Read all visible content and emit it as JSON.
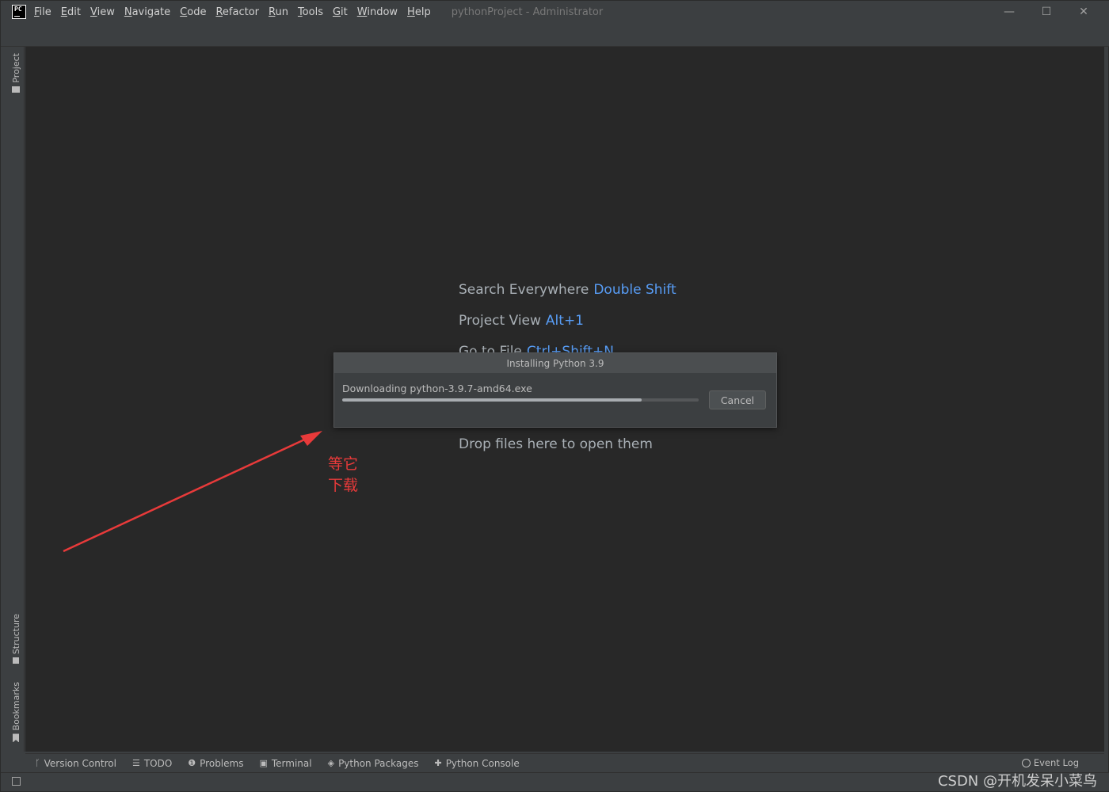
{
  "titlebar": {
    "logo": "PC",
    "menu": [
      {
        "first": "F",
        "rest": "ile"
      },
      {
        "first": "E",
        "rest": "dit"
      },
      {
        "first": "V",
        "rest": "iew"
      },
      {
        "first": "N",
        "rest": "avigate"
      },
      {
        "first": "C",
        "rest": "ode"
      },
      {
        "first": "R",
        "rest": "efactor"
      },
      {
        "first": "R",
        "rest": "un"
      },
      {
        "first": "T",
        "rest": "ools"
      },
      {
        "first": "G",
        "rest": "it"
      },
      {
        "first": "W",
        "rest": "indow"
      },
      {
        "first": "H",
        "rest": "elp"
      }
    ],
    "window_title": "pythonProject - Administrator",
    "controls": {
      "minimize": "—",
      "maximize": "☐",
      "close": "✕"
    }
  },
  "left_stripe": {
    "project": "Project",
    "structure": "Structure",
    "bookmarks": "Bookmarks"
  },
  "editor": {
    "hints": [
      {
        "label": "Search Everywhere",
        "key": "Double Shift"
      },
      {
        "label": "Project View",
        "key": "Alt+1"
      },
      {
        "label": "Go to File",
        "key": "Ctrl+Shift+N"
      }
    ],
    "drop_hint": "Drop files here to open them"
  },
  "dialog": {
    "title": "Installing Python 3.9",
    "status": "Downloading python-3.9.7-amd64.exe",
    "progress": 0.84,
    "cancel_label": "Cancel"
  },
  "annotation": {
    "line1": "等它",
    "line2": "下载",
    "color": "#e83a3a"
  },
  "bottom_bar": {
    "tabs": [
      {
        "icon": "version-control-icon",
        "glyph": "ᚴ",
        "label": "Version Control"
      },
      {
        "icon": "todo-icon",
        "glyph": "☰",
        "label": "TODO"
      },
      {
        "icon": "problems-icon",
        "glyph": "❶",
        "label": "Problems"
      },
      {
        "icon": "terminal-icon",
        "glyph": "▣",
        "label": "Terminal"
      },
      {
        "icon": "python-packages-icon",
        "glyph": "◈",
        "label": "Python Packages"
      },
      {
        "icon": "python-console-icon",
        "glyph": "✚",
        "label": "Python Console"
      }
    ],
    "event_log": "Event Log"
  },
  "status_bar": {
    "watermark": "CSDN @开机发呆小菜鸟"
  },
  "colors": {
    "editor_bg": "#282828",
    "key_blue": "#589df6",
    "chrome": "#3c3f41"
  }
}
